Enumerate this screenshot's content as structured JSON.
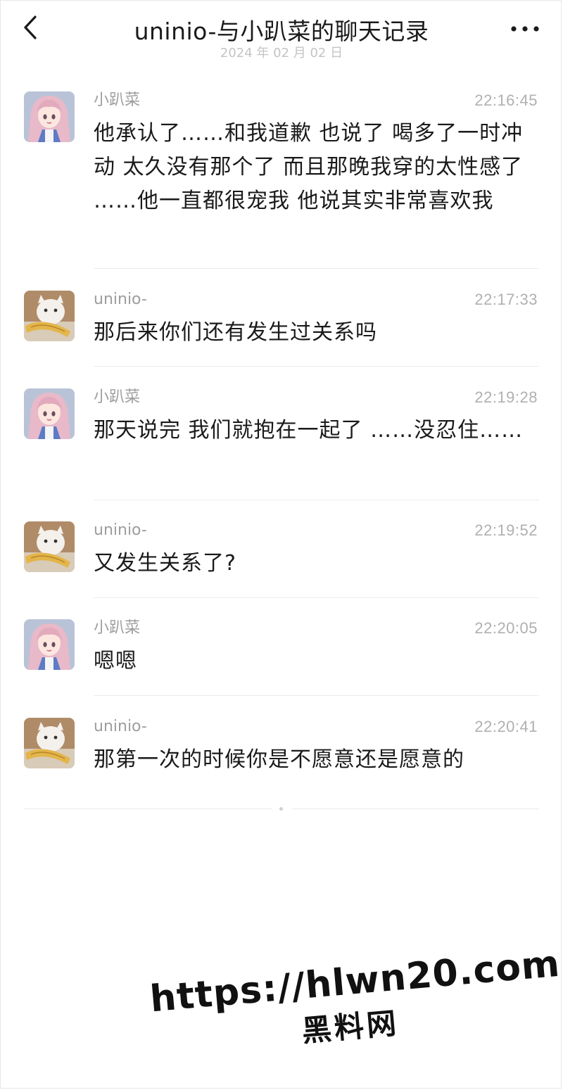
{
  "header": {
    "title": "uninio-与小趴菜的聊天记录",
    "date": "2024 年 02 月 02 日",
    "back_icon": "chevron-left-icon",
    "more_icon": "more-horizontal-icon"
  },
  "messages": [
    {
      "sender": "小趴菜",
      "time": "22:16:45",
      "text": "他承认了……和我道歉  也说了  喝多了一时冲动   太久没有那个了   而且那晚我穿的太性感了  ……他一直都很宠我  他说其实非常喜欢我",
      "avatar": "anime-girl-avatar"
    },
    {
      "sender": "uninio-",
      "time": "22:17:33",
      "text": "那后来你们还有发生过关系吗",
      "avatar": "white-cat-avatar"
    },
    {
      "sender": "小趴菜",
      "time": "22:19:28",
      "text": "那天说完  我们就抱在一起了  ……没忍住……",
      "avatar": "anime-girl-avatar"
    },
    {
      "sender": "uninio-",
      "time": "22:19:52",
      "text": "又发生关系了?",
      "avatar": "white-cat-avatar"
    },
    {
      "sender": "小趴菜",
      "time": "22:20:05",
      "text": "嗯嗯",
      "avatar": "anime-girl-avatar"
    },
    {
      "sender": "uninio-",
      "time": "22:20:41",
      "text": "那第一次的时候你是不愿意还是愿意的",
      "avatar": "white-cat-avatar"
    }
  ],
  "watermark": {
    "url": "https://hlwn20.com",
    "name": "黑料网"
  },
  "colors": {
    "text": "#1a1a1a",
    "meta": "#9d9d9d",
    "divider": "#ececec"
  }
}
